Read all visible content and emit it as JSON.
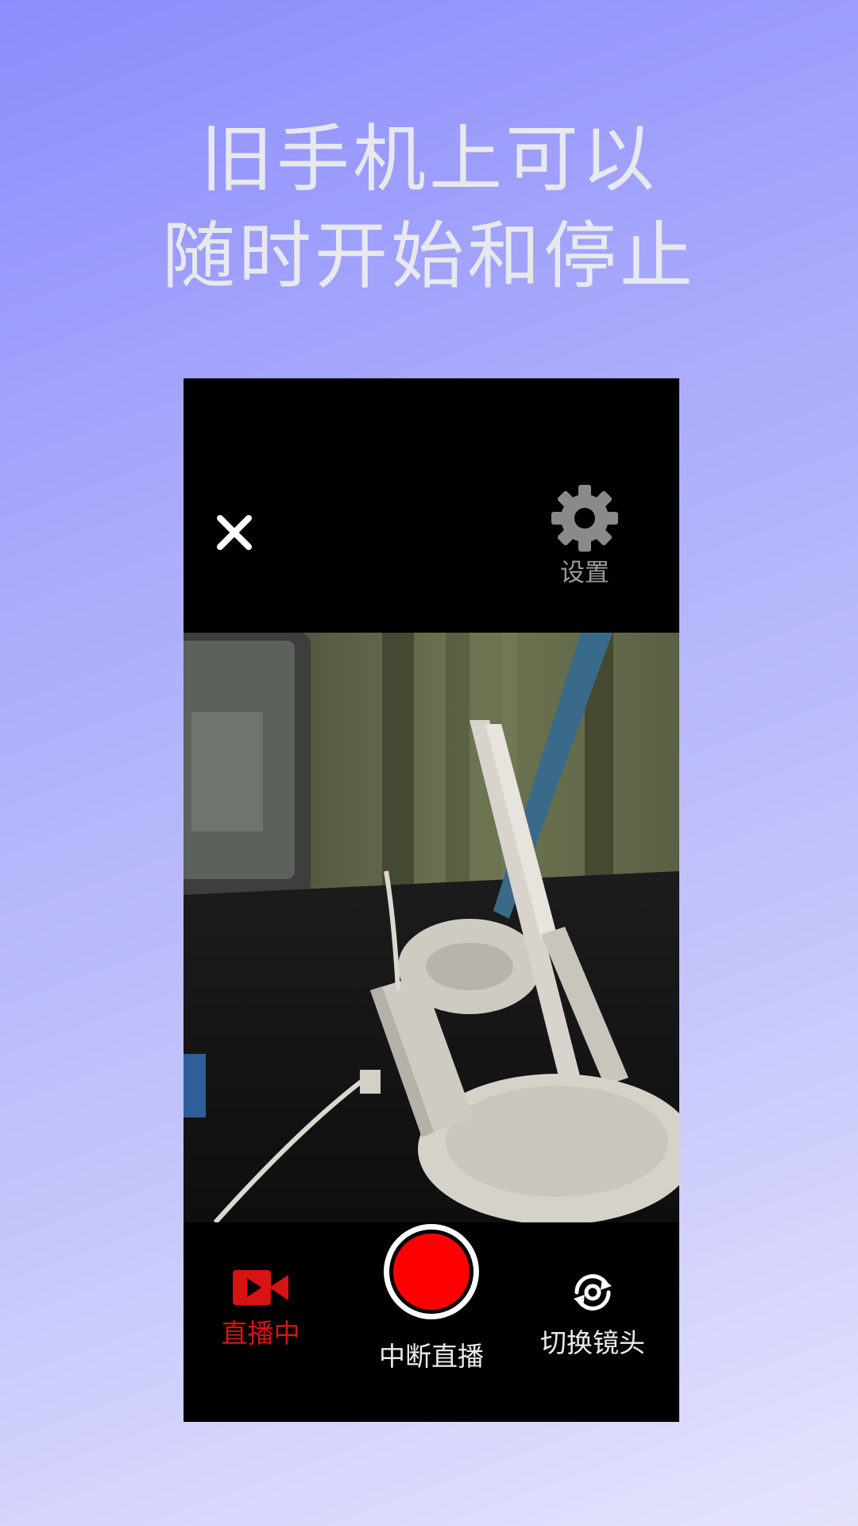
{
  "promo": {
    "headline_line1": "旧手机上可以",
    "headline_line2": "随时开始和停止"
  },
  "topbar": {
    "close_icon": "close-icon",
    "settings_icon": "gear-icon",
    "settings_label": "设置"
  },
  "controls": {
    "live_label": "直播中",
    "live_icon": "video-camera-icon",
    "stop_label": "中断直播",
    "stop_icon": "record-icon",
    "switch_label": "切换镜头",
    "switch_icon": "camera-switch-icon"
  },
  "colors": {
    "background_top": "#8b8dfc",
    "background_bottom": "#e4e3fd",
    "headline_text": "#e8e8ee",
    "live_active": "#d81313",
    "record_red": "#ff0000",
    "settings_gray": "#8a8a8a"
  }
}
